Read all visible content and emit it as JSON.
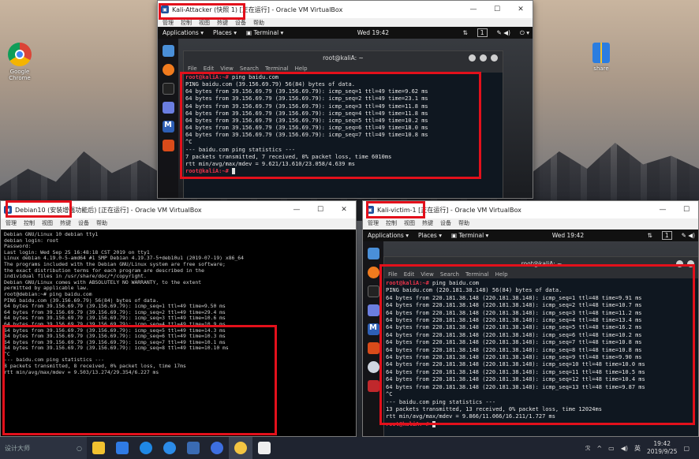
{
  "desktop": {
    "icons": [
      {
        "label": "Google Chrome",
        "name": "chrome-icon"
      },
      {
        "label": "share",
        "name": "share-folder-icon"
      }
    ]
  },
  "attacker": {
    "window_title": "Kali-Attacker (快照 1) [正在运行] - Oracle VM VirtualBox",
    "menu": [
      "管理",
      "控制",
      "视图",
      "热键",
      "设备",
      "帮助"
    ],
    "gnome": {
      "applications": "Applications ▾",
      "places": "Places ▾",
      "terminal": "Terminal ▾",
      "clock": "Wed 19:42",
      "workspace": "1"
    },
    "terminal_title": "root@kaliA: ~",
    "terminal_menu": [
      "File",
      "Edit",
      "View",
      "Search",
      "Terminal",
      "Help"
    ],
    "prompt": "root@kaliA:~#",
    "command": " ping baidu.com",
    "lines": [
      "PING baidu.com (39.156.69.79) 56(84) bytes of data.",
      "64 bytes from 39.156.69.79 (39.156.69.79): icmp_seq=1 ttl=49 time=9.62 ms",
      "64 bytes from 39.156.69.79 (39.156.69.79): icmp_seq=2 ttl=49 time=23.1 ms",
      "64 bytes from 39.156.69.79 (39.156.69.79): icmp_seq=3 ttl=49 time=11.8 ms",
      "64 bytes from 39.156.69.79 (39.156.69.79): icmp_seq=4 ttl=49 time=11.8 ms",
      "64 bytes from 39.156.69.79 (39.156.69.79): icmp_seq=5 ttl=49 time=10.2 ms",
      "64 bytes from 39.156.69.79 (39.156.69.79): icmp_seq=6 ttl=49 time=18.0 ms",
      "64 bytes from 39.156.69.79 (39.156.69.79): icmp_seq=7 ttl=49 time=10.8 ms",
      "^C",
      "--- baidu.com ping statistics ---",
      "7 packets transmitted, 7 received, 0% packet loss, time 6010ms",
      "rtt min/avg/max/mdev = 9.621/13.610/23.058/4.639 ms"
    ],
    "final_prompt": "root@kaliA:~# "
  },
  "debian": {
    "window_title": "Debian10 (安装增强功能后) [正在运行] - Oracle VM VirtualBox",
    "menu": [
      "管理",
      "控制",
      "视图",
      "热键",
      "设备",
      "帮助"
    ],
    "pre_lines": [
      "",
      "Debian GNU/Linux 10 debian tty1",
      "",
      "debian login: root",
      "Password:",
      "Last login: Wed Sep 25 16:48:18 CST 2019 on tty1",
      "Linux debian 4.19.0-5-amd64 #1 SMP Debian 4.19.37-5+deb10u1 (2019-07-19) x86_64",
      "",
      "The programs included with the Debian GNU/Linux system are free software;",
      "the exact distribution terms for each program are described in the",
      "individual files in /usr/share/doc/*/copyright.",
      "",
      "Debian GNU/Linux comes with ABSOLUTELY NO WARRANTY, to the extent",
      "permitted by applicable law."
    ],
    "ping_lines": [
      "root@debian:~# ping baidu.com",
      "PING baidu.com (39.156.69.79) 56(84) bytes of data.",
      "64 bytes from 39.156.69.79 (39.156.69.79): icmp_seq=1 ttl=49 time=9.50 ms",
      "64 bytes from 39.156.69.79 (39.156.69.79): icmp_seq=2 ttl=49 time=29.4 ms",
      "64 bytes from 39.156.69.79 (39.156.69.79): icmp_seq=3 ttl=49 time=10.6 ms",
      "64 bytes from 39.156.69.79 (39.156.69.79): icmp_seq=4 ttl=49 time=10.9 ms",
      "64 bytes from 39.156.69.79 (39.156.69.79): icmp_seq=5 ttl=49 time=14.3 ms",
      "64 bytes from 39.156.69.79 (39.156.69.79): icmp_seq=6 ttl=49 time=10.3 ms",
      "64 bytes from 39.156.69.79 (39.156.69.79): icmp_seq=7 ttl=49 time=10.1 ms",
      "64 bytes from 39.156.69.79 (39.156.69.79): icmp_seq=8 ttl=49 time=10.10 ms",
      "^C",
      "--- baidu.com ping statistics ---",
      "8 packets transmitted, 8 received, 0% packet loss, time 17ms",
      "rtt min/avg/max/mdev = 9.503/13.274/29.354/6.227 ms"
    ]
  },
  "victim": {
    "window_title": "Kali-victim-1 [正在运行] - Oracle VM VirtualBox",
    "menu": [
      "管理",
      "控制",
      "视图",
      "热键",
      "设备",
      "帮助"
    ],
    "gnome": {
      "applications": "Applications ▾",
      "places": "Places ▾",
      "terminal": "Terminal ▾",
      "clock": "Wed 19:42",
      "workspace": "1"
    },
    "terminal_title": "root@kaliA: ~",
    "terminal_menu": [
      "File",
      "Edit",
      "View",
      "Search",
      "Terminal",
      "Help"
    ],
    "prompt": "root@kaliA:~#",
    "command": " ping baidu.com",
    "lines": [
      "PING baidu.com (220.181.38.148) 56(84) bytes of data.",
      "64 bytes from 220.181.38.148 (220.181.38.148): icmp_seq=1 ttl=48 time=9.91 ms",
      "64 bytes from 220.181.38.148 (220.181.38.148): icmp_seq=2 ttl=48 time=10.7 ms",
      "64 bytes from 220.181.38.148 (220.181.38.148): icmp_seq=3 ttl=48 time=11.2 ms",
      "64 bytes from 220.181.38.148 (220.181.38.148): icmp_seq=4 ttl=48 time=13.4 ms",
      "64 bytes from 220.181.38.148 (220.181.38.148): icmp_seq=5 ttl=48 time=16.2 ms",
      "64 bytes from 220.181.38.148 (220.181.38.148): icmp_seq=6 ttl=48 time=10.2 ms",
      "64 bytes from 220.181.38.148 (220.181.38.148): icmp_seq=7 ttl=48 time=10.8 ms",
      "64 bytes from 220.181.38.148 (220.181.38.148): icmp_seq=8 ttl=48 time=10.8 ms",
      "64 bytes from 220.181.38.148 (220.181.38.148): icmp_seq=9 ttl=48 time=9.90 ms",
      "64 bytes from 220.181.38.148 (220.181.38.148): icmp_seq=10 ttl=48 time=10.0 ms",
      "64 bytes from 220.181.38.148 (220.181.38.148): icmp_seq=11 ttl=48 time=10.5 ms",
      "64 bytes from 220.181.38.148 (220.181.38.148): icmp_seq=12 ttl=48 time=10.4 ms",
      "64 bytes from 220.181.38.148 (220.181.38.148): icmp_seq=13 ttl=48 time=9.87 ms",
      "^C",
      "--- baidu.com ping statistics ---",
      "13 packets transmitted, 13 received, 0% packet loss, time 12024ms",
      "rtt min/avg/max/mdev = 9.866/11.066/16.211/1.727 ms"
    ],
    "final_prompt": "root@kaliA:~# "
  },
  "taskbar": {
    "search_placeholder": "设计大师",
    "tray_ime": "英",
    "time": "19:42",
    "date": "2019/9/25"
  },
  "colors": {
    "highlight_box": "#e3101b",
    "root_prompt": "#e8344a"
  }
}
